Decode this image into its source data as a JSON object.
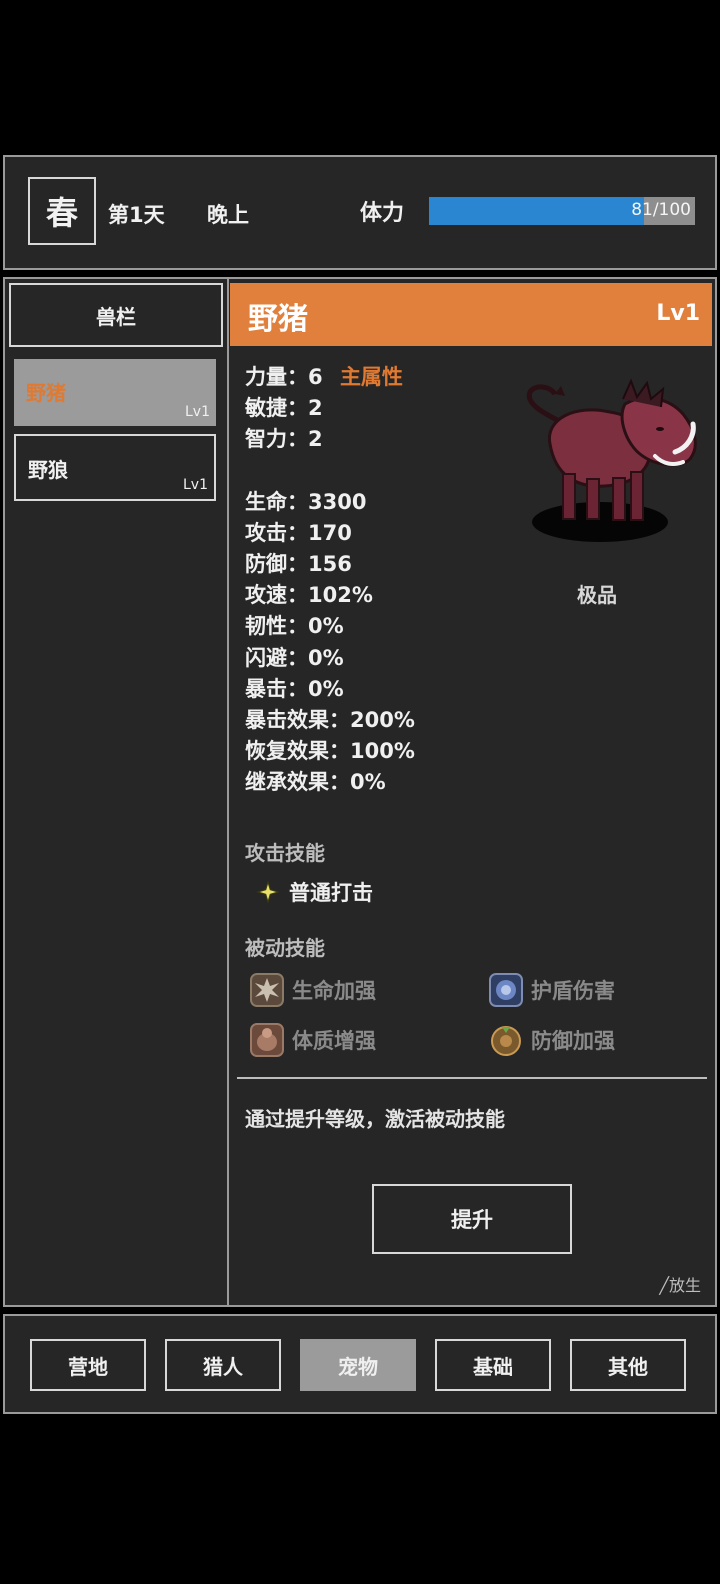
{
  "header": {
    "season": "春",
    "day": "第1天",
    "time_of_day": "晚上",
    "stamina_label": "体力",
    "stamina_text": "81/100",
    "stamina_current": 81,
    "stamina_max": 100
  },
  "sidebar": {
    "title": "兽栏",
    "items": [
      {
        "name": "野猪",
        "level": "Lv1",
        "selected": true
      },
      {
        "name": "野狼",
        "level": "Lv1",
        "selected": false
      }
    ]
  },
  "detail": {
    "name": "野猪",
    "level": "Lv1",
    "main_attr_label": "主属性",
    "quality": "极品",
    "attributes": [
      "力量：6",
      "敏捷：2",
      "智力：2"
    ],
    "stats": [
      "生命：3300",
      "攻击：170",
      "防御：156",
      "攻速：102%",
      "韧性：0%",
      "闪避：0%",
      "暴击：0%",
      "暴击效果：200%",
      "恢复效果：100%",
      "继承效果：0%"
    ],
    "attack_skills_title": "攻击技能",
    "attack_skills": [
      "普通打击"
    ],
    "passive_skills_title": "被动技能",
    "passive_skills": [
      "生命加强",
      "护盾伤害",
      "体质增强",
      "防御加强"
    ],
    "hint": "通过提升等级，激活被动技能",
    "upgrade_label": "提升",
    "release_label": "╱放生"
  },
  "nav": {
    "items": [
      "营地",
      "猎人",
      "宠物",
      "基础",
      "其他"
    ],
    "active": "宠物"
  },
  "colors": {
    "accent": "#e17f3c",
    "stamina_bar": "#2a86d0",
    "selected_bg": "#9b9b9b",
    "panel_bg": "#262626"
  }
}
